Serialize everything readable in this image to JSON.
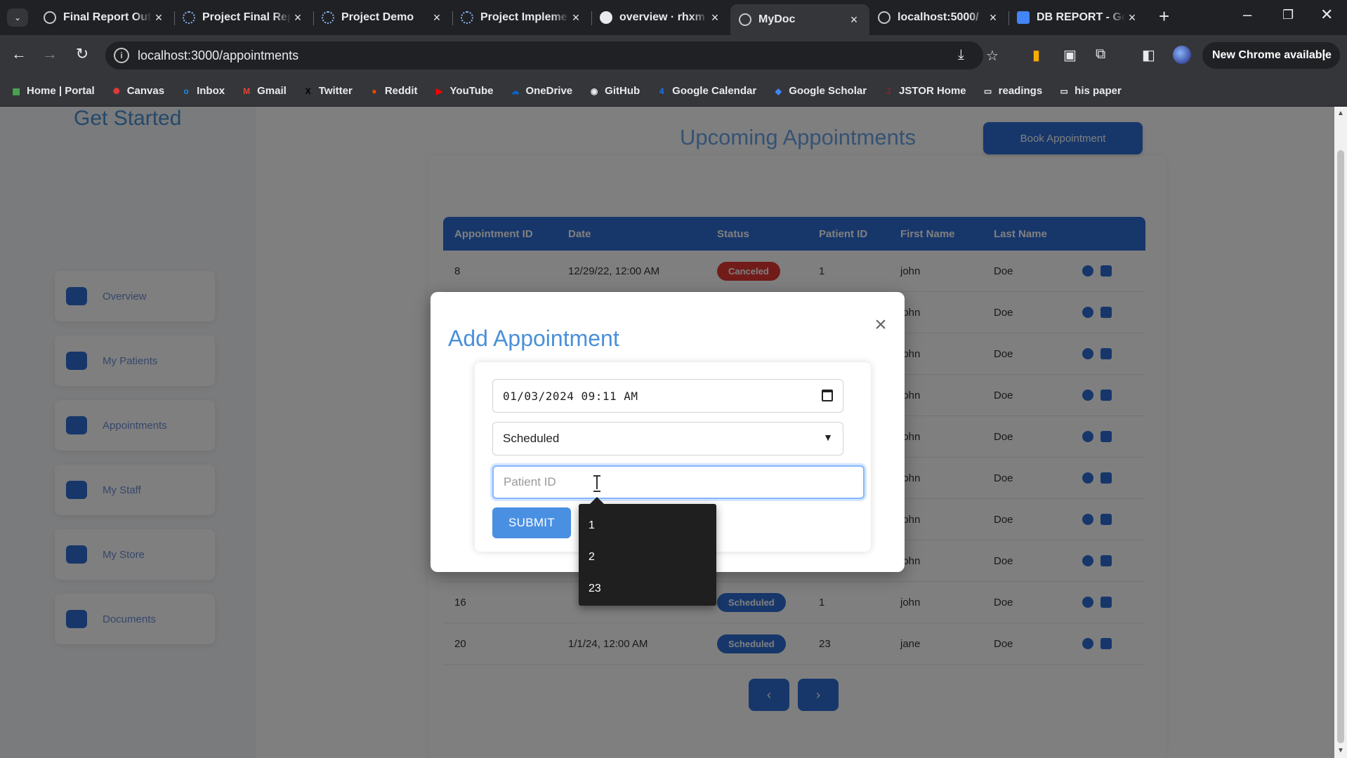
{
  "browser": {
    "tabs": [
      {
        "title": "Final Report Out",
        "icon": "globe-icon"
      },
      {
        "title": "Project Final Rep",
        "icon": "gear-icon"
      },
      {
        "title": "Project Demo",
        "icon": "gear-icon"
      },
      {
        "title": "Project Impleme",
        "icon": "gear-icon"
      },
      {
        "title": "overview · rhxm",
        "icon": "github-icon"
      },
      {
        "title": "MyDoc",
        "icon": "globe-icon",
        "active": true
      },
      {
        "title": "localhost:5000/",
        "icon": "globe-icon"
      },
      {
        "title": "DB REPORT - Go",
        "icon": "docs-icon"
      }
    ],
    "url": "localhost:3000/appointments",
    "update_button": "New Chrome available",
    "bookmarks": [
      {
        "label": "Home | Portal",
        "icon": "portal-icon",
        "color": "#4caf50"
      },
      {
        "label": "Canvas",
        "icon": "canvas-icon",
        "color": "#e53935"
      },
      {
        "label": "Inbox",
        "icon": "outlook-icon",
        "color": "#1e88e5"
      },
      {
        "label": "Gmail",
        "icon": "gmail-icon",
        "color": "#ea4335"
      },
      {
        "label": "Twitter",
        "icon": "x-icon",
        "color": "#000000"
      },
      {
        "label": "Reddit",
        "icon": "reddit-icon",
        "color": "#ff4500"
      },
      {
        "label": "YouTube",
        "icon": "youtube-icon",
        "color": "#ff0000"
      },
      {
        "label": "OneDrive",
        "icon": "onedrive-icon",
        "color": "#0a64c8"
      },
      {
        "label": "GitHub",
        "icon": "github-icon",
        "color": "#e8eaed"
      },
      {
        "label": "Google Calendar",
        "icon": "calendar-icon",
        "color": "#1a73e8"
      },
      {
        "label": "Google Scholar",
        "icon": "scholar-icon",
        "color": "#4285f4"
      },
      {
        "label": "JSTOR Home",
        "icon": "jstor-icon",
        "color": "#9c1c2c"
      },
      {
        "label": "readings",
        "icon": "folder-icon",
        "color": "#e8eaed"
      },
      {
        "label": "his paper",
        "icon": "folder-icon",
        "color": "#e8eaed"
      }
    ]
  },
  "app": {
    "brand": "Get Started",
    "page_title": "Upcoming Appointments",
    "add_button": "Book Appointment",
    "sidebar": [
      "Overview",
      "My Patients",
      "Appointments",
      "My Staff",
      "My Store",
      "Documents"
    ],
    "table": {
      "headers": [
        "Appointment ID",
        "Date",
        "Status",
        "Patient ID",
        "First Name",
        "Last Name"
      ],
      "rows": [
        {
          "id": "8",
          "date": "12/29/22, 12:00 AM",
          "status": "Canceled",
          "status_color": "red",
          "pid": "1",
          "first": "john",
          "last": "Doe"
        },
        {
          "id": "",
          "date": "",
          "status": "",
          "pid": "",
          "first": "john",
          "last": "Doe"
        },
        {
          "id": "",
          "date": "",
          "status": "",
          "pid": "",
          "first": "john",
          "last": "Doe"
        },
        {
          "id": "",
          "date": "",
          "status": "",
          "pid": "",
          "first": "john",
          "last": "Doe"
        },
        {
          "id": "",
          "date": "",
          "status": "",
          "pid": "",
          "first": "john",
          "last": "Doe"
        },
        {
          "id": "",
          "date": "",
          "status": "",
          "pid": "",
          "first": "john",
          "last": "Doe"
        },
        {
          "id": "",
          "date": "",
          "status": "",
          "pid": "",
          "first": "john",
          "last": "Doe"
        },
        {
          "id": "",
          "date": "",
          "status": "",
          "pid": "",
          "first": "john",
          "last": "Doe"
        },
        {
          "id": "16",
          "date": "",
          "status": "Scheduled",
          "status_color": "blue",
          "pid": "1",
          "first": "john",
          "last": "Doe"
        },
        {
          "id": "20",
          "date": "1/1/24, 12:00 AM",
          "status": "Scheduled",
          "status_color": "blue",
          "pid": "23",
          "first": "jane",
          "last": "Doe"
        }
      ]
    },
    "pager": [
      "‹",
      "›"
    ]
  },
  "modal": {
    "title": "Add Appointment",
    "close": "×",
    "datetime_value": "01/03/2024 09:11 AM",
    "status_value": "Scheduled",
    "patient_placeholder": "Patient ID",
    "submit": "SUBMIT",
    "suggestions": [
      "1",
      "2",
      "23"
    ]
  }
}
